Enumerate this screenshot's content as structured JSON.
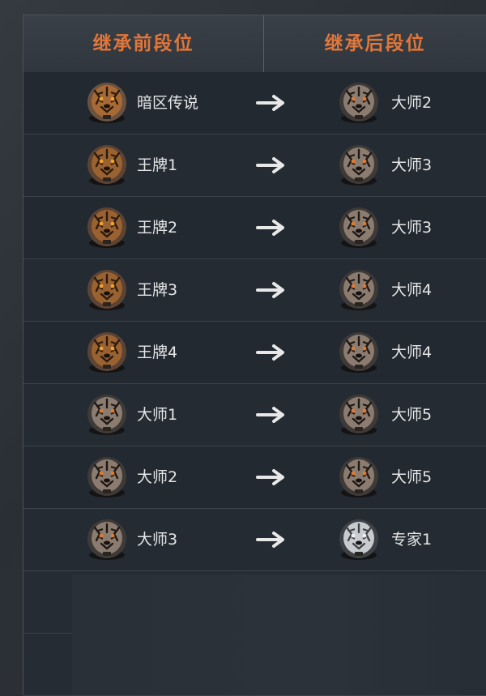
{
  "header": {
    "before_label": "继承前段位",
    "after_label": "继承后段位"
  },
  "rows": [
    {
      "before": {
        "rank": "暗区传说",
        "icon": "legend-tiger-badge-icon"
      },
      "after": {
        "rank": "大师2",
        "icon": "master-tiger-badge-icon"
      }
    },
    {
      "before": {
        "rank": "王牌1",
        "icon": "ace-tiger-badge-icon"
      },
      "after": {
        "rank": "大师3",
        "icon": "master-tiger-badge-icon"
      }
    },
    {
      "before": {
        "rank": "王牌2",
        "icon": "ace-tiger-badge-icon"
      },
      "after": {
        "rank": "大师3",
        "icon": "master-tiger-badge-icon"
      }
    },
    {
      "before": {
        "rank": "王牌3",
        "icon": "ace-tiger-badge-icon"
      },
      "after": {
        "rank": "大师4",
        "icon": "master-tiger-badge-icon"
      }
    },
    {
      "before": {
        "rank": "王牌4",
        "icon": "ace-tiger-badge-icon"
      },
      "after": {
        "rank": "大师4",
        "icon": "master-tiger-badge-icon"
      }
    },
    {
      "before": {
        "rank": "大师1",
        "icon": "master-tiger-badge-icon"
      },
      "after": {
        "rank": "大师5",
        "icon": "master-tiger-badge-icon"
      }
    },
    {
      "before": {
        "rank": "大师2",
        "icon": "master-tiger-badge-icon"
      },
      "after": {
        "rank": "大师5",
        "icon": "master-tiger-badge-icon"
      }
    },
    {
      "before": {
        "rank": "大师3",
        "icon": "master-tiger-badge-icon"
      },
      "after": {
        "rank": "专家1",
        "icon": "expert-wolf-badge-icon"
      }
    }
  ],
  "colors": {
    "header_text": "#e0763a",
    "row_text": "#e6e6e6",
    "arrow": "#e8e8e8"
  }
}
